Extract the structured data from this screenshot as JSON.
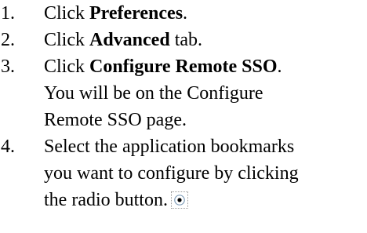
{
  "steps": [
    {
      "number": "1.",
      "lines": [
        {
          "prefix": "Click ",
          "bold": "Preferences",
          "suffix": "."
        }
      ]
    },
    {
      "number": "2.",
      "lines": [
        {
          "prefix": "Click ",
          "bold": "Advanced",
          "suffix": " tab."
        }
      ]
    },
    {
      "number": "3.",
      "lines": [
        {
          "prefix": "Click ",
          "bold": "Configure Remote SSO",
          "suffix": "."
        }
      ],
      "note": [
        "You will be on the Configure",
        "Remote SSO page."
      ]
    },
    {
      "number": "4.",
      "lines": [
        "Select the application bookmarks",
        "you want to configure by clicking",
        "the radio button."
      ],
      "icon": "radio-button-selected-icon"
    }
  ]
}
